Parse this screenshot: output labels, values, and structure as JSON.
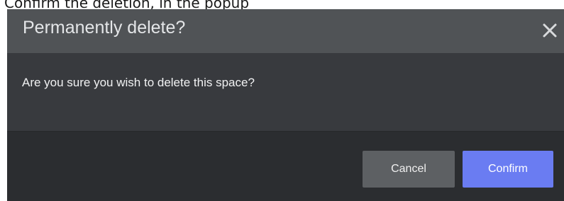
{
  "caption": "Confirm the deletion, in the popup",
  "dialog": {
    "title": "Permanently delete?",
    "close_icon": "close-icon",
    "message": "Are you sure you wish to delete this space?",
    "cancel_label": "Cancel",
    "confirm_label": "Confirm"
  },
  "colors": {
    "header_bg": "#505356",
    "body_bg": "#383a3e",
    "footer_bg": "#2b2d30",
    "cancel_bg": "#5d6063",
    "confirm_bg": "#6a7cf2"
  }
}
